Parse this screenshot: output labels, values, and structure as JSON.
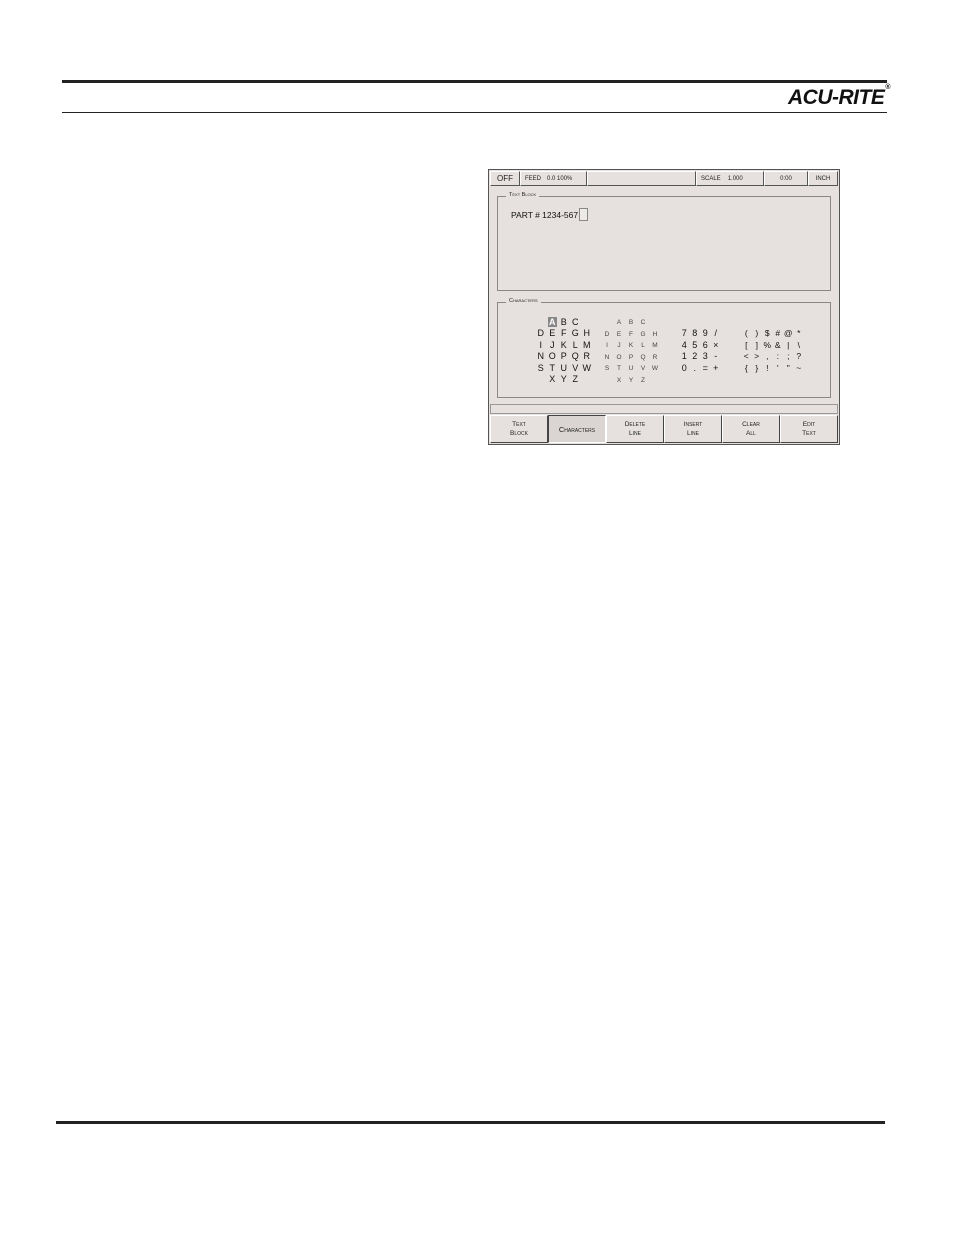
{
  "header": {
    "logo": "ACU-RITE",
    "logo_mark": "®"
  },
  "status_bar": {
    "mode": "OFF",
    "feed_label": "FEED",
    "feed_value": "0.0  100%",
    "scale_label": "SCALE",
    "scale_value": "1.000",
    "time": "0:00",
    "units": "INCH"
  },
  "text_block": {
    "title": "Text Block",
    "line": "PART # 1234-567"
  },
  "characters": {
    "title": "Characters",
    "uppercase": [
      "",
      "A",
      "B",
      "C",
      "",
      "D",
      "E",
      "F",
      "G",
      "H",
      "I",
      "J",
      "K",
      "L",
      "M",
      "N",
      "O",
      "P",
      "Q",
      "R",
      "S",
      "T",
      "U",
      "V",
      "W",
      "",
      "X",
      "Y",
      "Z",
      ""
    ],
    "selected": "A",
    "lowercase": [
      "",
      "A",
      "B",
      "C",
      "",
      "D",
      "E",
      "F",
      "G",
      "H",
      "I",
      "J",
      "K",
      "L",
      "M",
      "N",
      "O",
      "P",
      "Q",
      "R",
      "S",
      "T",
      "U",
      "V",
      "W",
      "",
      "X",
      "Y",
      "Z",
      ""
    ],
    "digits": [
      "",
      "",
      "",
      "",
      "7",
      "8",
      "9",
      "/",
      "4",
      "5",
      "6",
      "×",
      "1",
      "2",
      "3",
      "-",
      "0",
      ".",
      "=",
      "+"
    ],
    "symbols": [
      "",
      "",
      "",
      "",
      "",
      "",
      "(",
      ")",
      "$",
      "#",
      "@",
      "*",
      "[",
      "]",
      "%",
      "&",
      "|",
      "\\",
      "<",
      ">",
      ",",
      ":",
      ";",
      "?",
      "{",
      "}",
      "!",
      "'",
      "\"",
      "~"
    ]
  },
  "softkeys": [
    {
      "label": "Text\nBlock"
    },
    {
      "label": "Characters",
      "active": true
    },
    {
      "label": "Delete\nLine"
    },
    {
      "label": "Insert\nLine"
    },
    {
      "label": "Clear\nAll"
    },
    {
      "label": "Edit\nText"
    }
  ]
}
